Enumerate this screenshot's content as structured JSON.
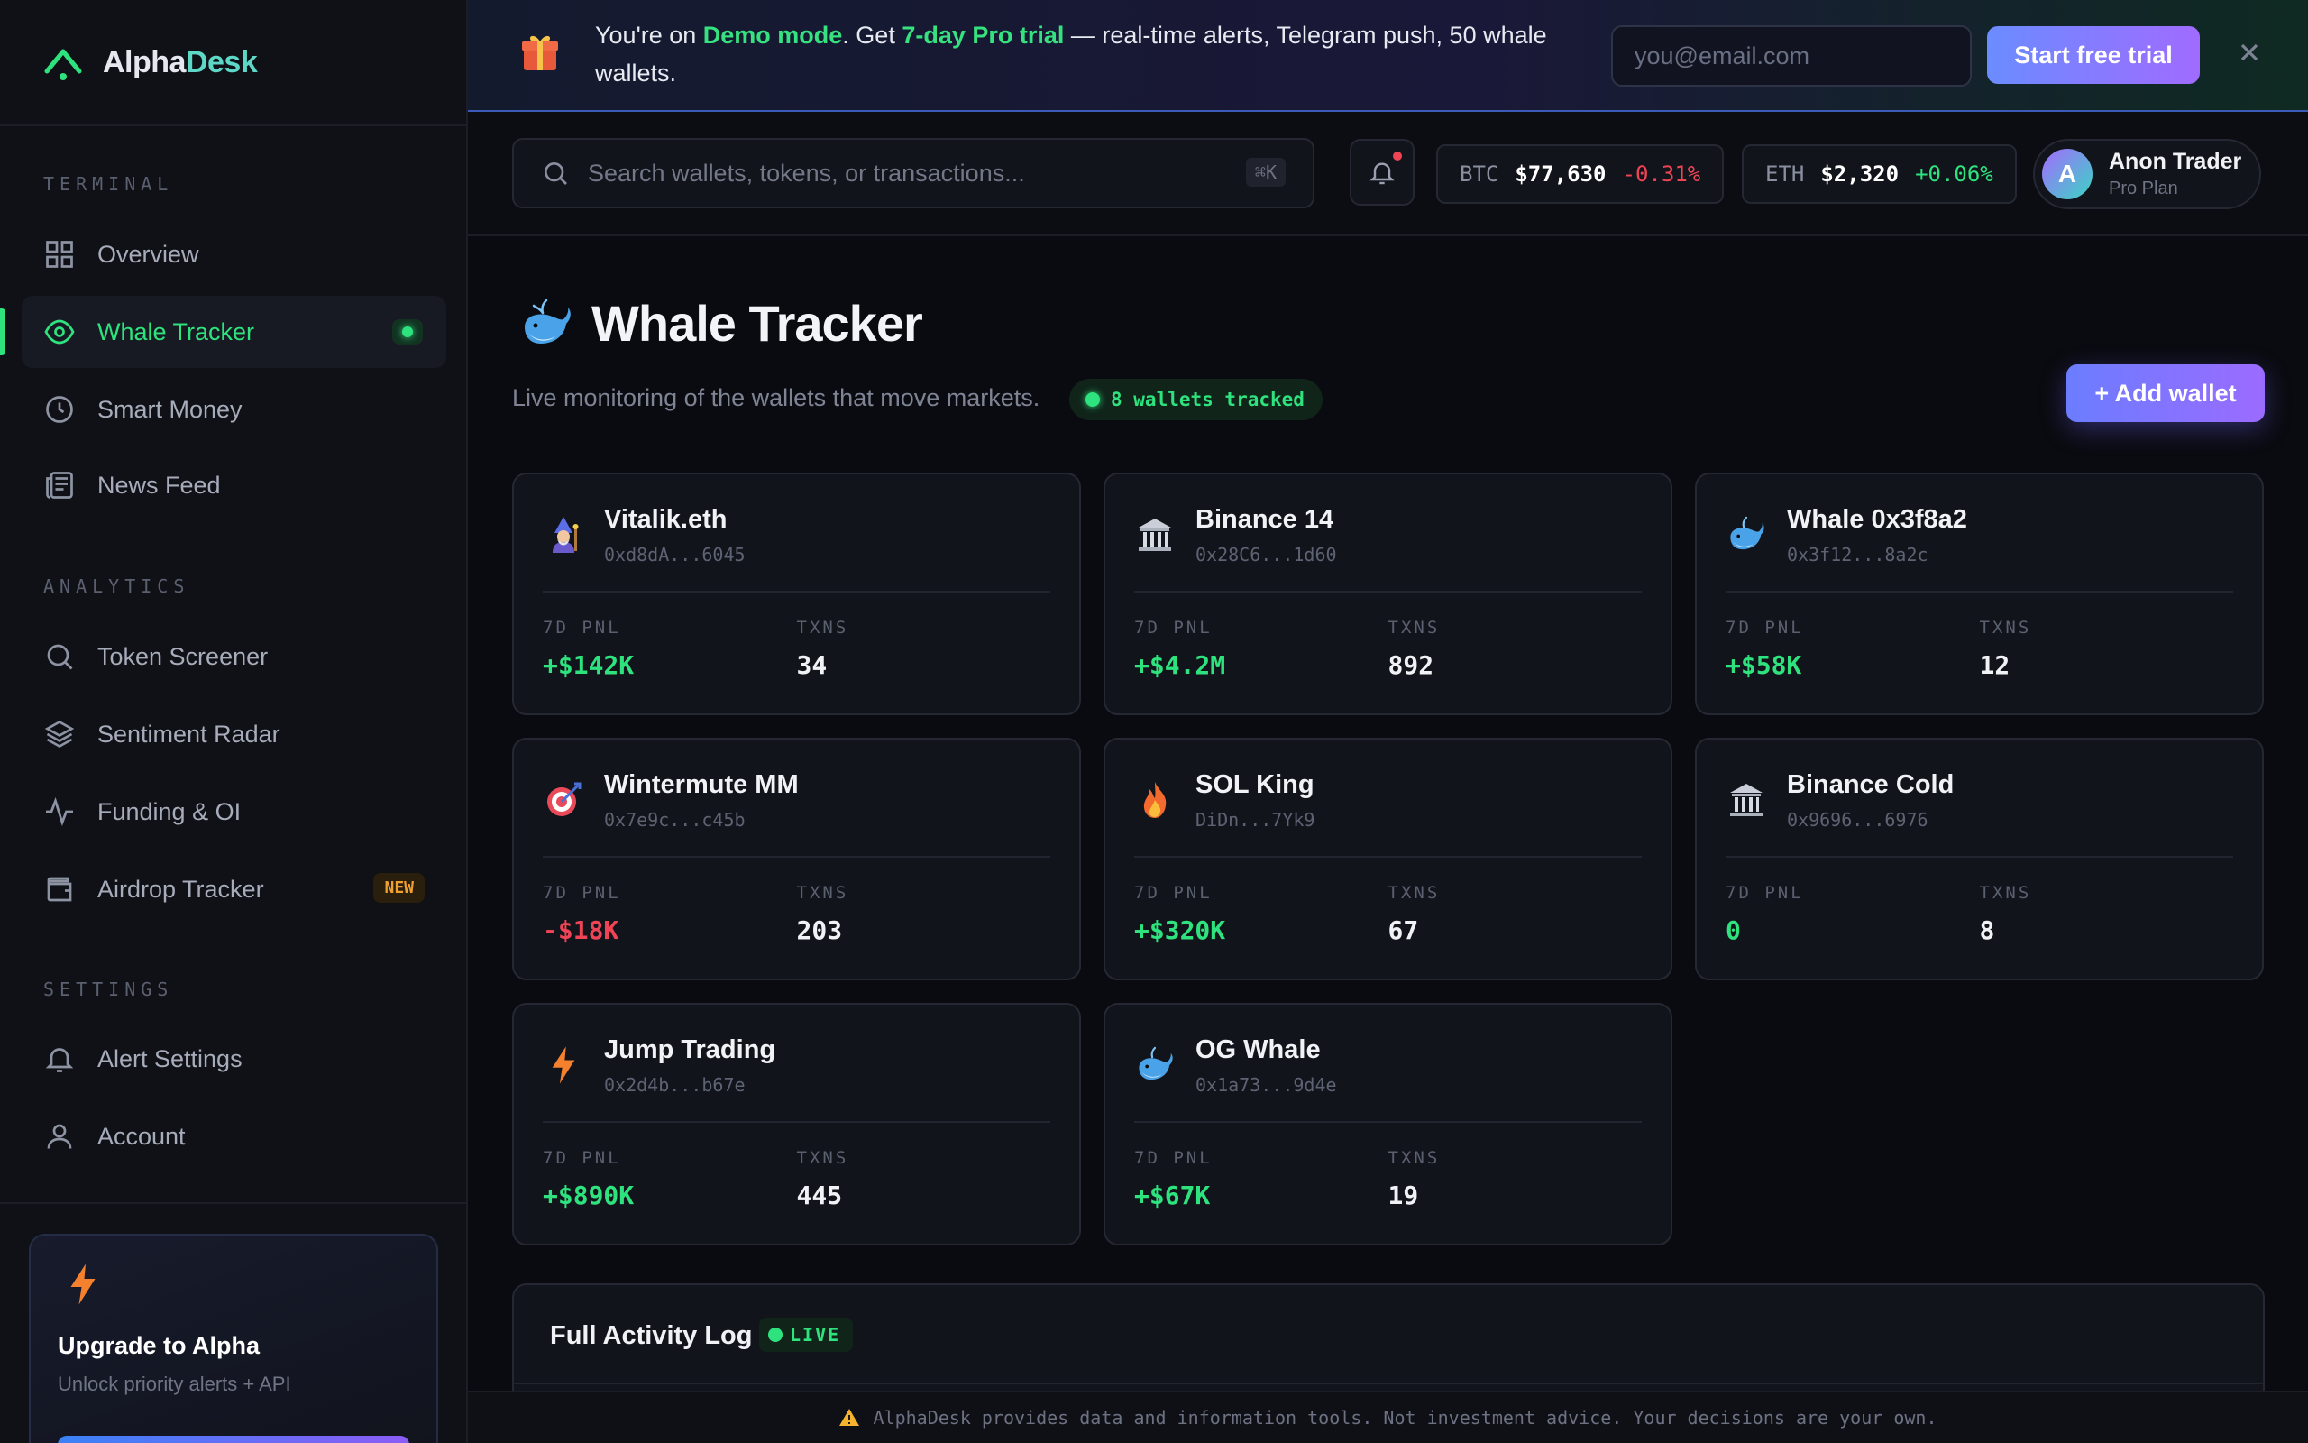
{
  "brand": {
    "name_part1": "Alpha",
    "name_part2": "Desk"
  },
  "sidebar": {
    "sections": [
      {
        "title": "TERMINAL",
        "items": [
          {
            "label": "Overview",
            "icon": "grid-icon"
          },
          {
            "label": "Whale Tracker",
            "icon": "eye-icon",
            "active": true
          },
          {
            "label": "Smart Money",
            "icon": "clock-icon"
          },
          {
            "label": "News Feed",
            "icon": "newspaper-icon"
          }
        ]
      },
      {
        "title": "ANALYTICS",
        "items": [
          {
            "label": "Token Screener",
            "icon": "search-icon"
          },
          {
            "label": "Sentiment Radar",
            "icon": "layers-icon"
          },
          {
            "label": "Funding & OI",
            "icon": "activity-icon"
          },
          {
            "label": "Airdrop Tracker",
            "icon": "wallet-icon",
            "badge": "NEW"
          }
        ]
      },
      {
        "title": "SETTINGS",
        "items": [
          {
            "label": "Alert Settings",
            "icon": "bell-icon"
          },
          {
            "label": "Account",
            "icon": "user-icon"
          }
        ]
      }
    ],
    "upgrade": {
      "title": "Upgrade to Alpha",
      "subtitle": "Unlock priority alerts + API"
    }
  },
  "banner": {
    "text_1": "You're on ",
    "highlight_1": "Demo mode",
    "text_2": ". Get ",
    "highlight_2": "7-day Pro trial",
    "text_3": " — real-time alerts, Telegram push, 50 whale wallets.",
    "email_placeholder": "you@email.com",
    "cta_label": "Start free trial",
    "close_label": "×"
  },
  "topbar": {
    "search_placeholder": "Search wallets, tokens, or transactions...",
    "search_shortcut": "⌘K",
    "tickers": [
      {
        "symbol": "BTC",
        "price": "$77,630",
        "change": "-0.31%",
        "direction": "down"
      },
      {
        "symbol": "ETH",
        "price": "$2,320",
        "change": "+0.06%",
        "direction": "up"
      }
    ],
    "user": {
      "initial": "A",
      "name": "Anon Trader",
      "plan": "Pro Plan"
    }
  },
  "page": {
    "title": "Whale Tracker",
    "subtitle": "Live monitoring of the wallets that move markets.",
    "tracked_badge": "8 wallets tracked",
    "add_button": "+ Add wallet"
  },
  "wallet_labels": {
    "pnl": "7D PNL",
    "txns": "TXNS"
  },
  "wallets": [
    {
      "name": "Vitalik.eth",
      "address": "0xd8dA...6045",
      "pnl": "+$142K",
      "pnl_dir": "pos",
      "txns": "34",
      "icon": "mage-icon"
    },
    {
      "name": "Binance 14",
      "address": "0x28C6...1d60",
      "pnl": "+$4.2M",
      "pnl_dir": "pos",
      "txns": "892",
      "icon": "bank-icon"
    },
    {
      "name": "Whale 0x3f8a2",
      "address": "0x3f12...8a2c",
      "pnl": "+$58K",
      "pnl_dir": "pos",
      "txns": "12",
      "icon": "whale-icon"
    },
    {
      "name": "Wintermute MM",
      "address": "0x7e9c...c45b",
      "pnl": "-$18K",
      "pnl_dir": "neg",
      "txns": "203",
      "icon": "target-icon"
    },
    {
      "name": "SOL King",
      "address": "DiDn...7Yk9",
      "pnl": "+$320K",
      "pnl_dir": "pos",
      "txns": "67",
      "icon": "fire-icon"
    },
    {
      "name": "Binance Cold",
      "address": "0x9696...6976",
      "pnl": "0",
      "pnl_dir": "pos",
      "txns": "8",
      "icon": "bank-icon"
    },
    {
      "name": "Jump Trading",
      "address": "0x2d4b...b67e",
      "pnl": "+$890K",
      "pnl_dir": "pos",
      "txns": "445",
      "icon": "bolt-icon"
    },
    {
      "name": "OG Whale",
      "address": "0x1a73...9d4e",
      "pnl": "+$67K",
      "pnl_dir": "pos",
      "txns": "19",
      "icon": "whale-icon"
    }
  ],
  "activity": {
    "title": "Full Activity Log",
    "live_label": "LIVE"
  },
  "footer": {
    "disclaimer": "AlphaDesk provides data and information tools. Not investment advice. Your decisions are your own."
  },
  "colors": {
    "accent_green": "#2ee37e",
    "negative_red": "#ef4456",
    "brand_teal": "#5dd8c6",
    "cta_purple": "#9b6bff"
  }
}
